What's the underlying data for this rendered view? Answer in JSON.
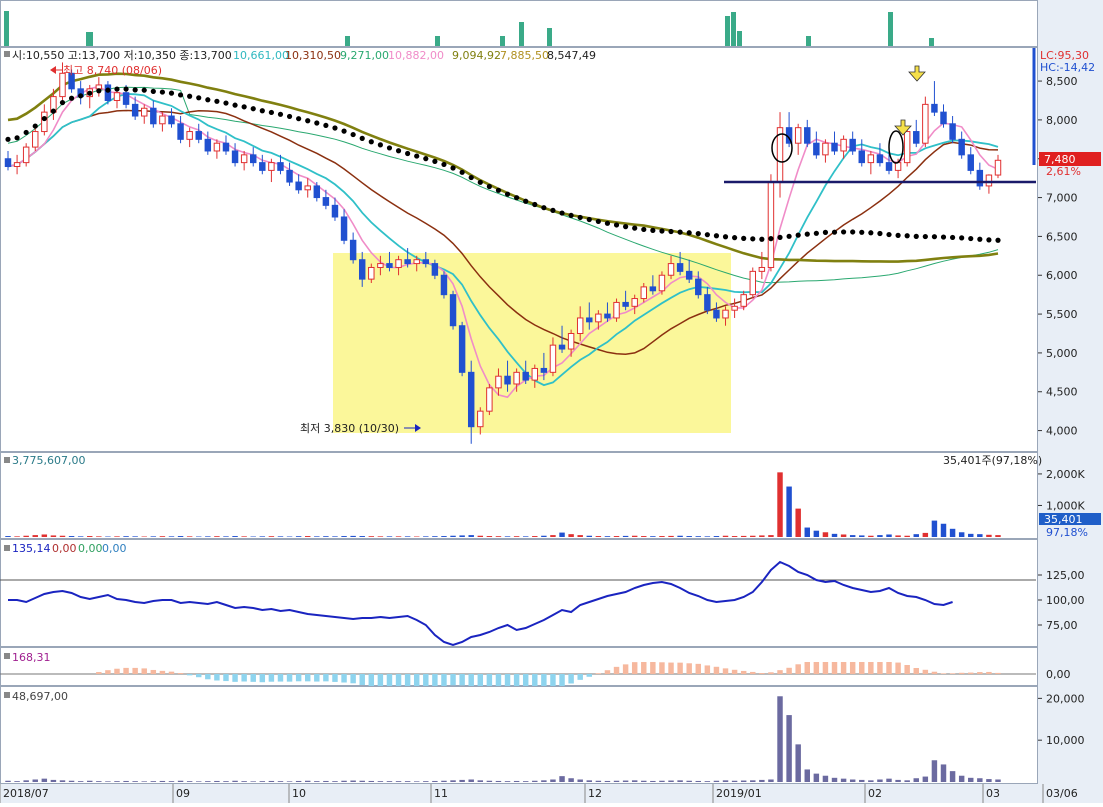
{
  "legend": {
    "ohlc": "시:10,550 고:13,700 저:10,350 종:13,700",
    "ma1": "10,661,00",
    "ma2": "10,310,50",
    "ma3": "9,271,00",
    "ma4": "10,882,00",
    "ma5": "9,094,92",
    "ma6": "7,885,50",
    "ma7": "8,547,49"
  },
  "colors": {
    "up": "#e03030",
    "down": "#2050d0",
    "ma5": "#f08cc8",
    "ma10": "#30c0c8",
    "ma20": "#8b3010",
    "ma60": "#2aa870",
    "ma120": "#808010",
    "dots": "#000000",
    "zone": "#fbf79a",
    "cci": "#1a24c0",
    "volIndicator": "#6b6aa0",
    "topBars": "#3aaa88"
  },
  "annotations": {
    "high": "최고 8,740 (08/06)",
    "low": "최저 3,830 (10/30)",
    "lc": "LC:95,30",
    "hc": "HC:-14,42",
    "last_price": "7,480",
    "last_change": "2,61%"
  },
  "volume_panel": {
    "value": "3,775,607,00",
    "right_value": "35,401주(97,18%)",
    "badge": "35,401",
    "badge_pct": "97,18%"
  },
  "osc_panel": {
    "value": "135,14",
    "v2": "0,00",
    "v3": "0,00",
    "v4": "0,00"
  },
  "macd_panel": {
    "value": "168,31"
  },
  "bottom_panel": {
    "value": "48,697,00"
  },
  "x_labels": [
    "2018/07",
    "09",
    "10",
    "11",
    "12",
    "2019/01",
    "02",
    "03",
    "03/06"
  ],
  "chart_data": {
    "type": "candlestick",
    "price_axis": {
      "ticks": [
        "8,500",
        "8,000",
        "7,500",
        "7,000",
        "6,500",
        "6,000",
        "5,500",
        "5,000",
        "4,500",
        "4,000"
      ],
      "range": [
        3750,
        8900
      ]
    },
    "volume_axis": {
      "ticks": [
        "2,000K",
        "1,000K"
      ]
    },
    "osc_axis": {
      "ticks": [
        "125,00",
        "100,00",
        "75,00"
      ]
    },
    "macd_axis": {
      "ticks": [
        "0,00"
      ]
    },
    "bottom_axis": {
      "ticks": [
        "20,000",
        "10,000"
      ]
    },
    "candles": [
      [
        7500,
        7600,
        7350,
        7400
      ],
      [
        7400,
        7550,
        7300,
        7450
      ],
      [
        7450,
        7700,
        7400,
        7650
      ],
      [
        7650,
        7900,
        7600,
        7850
      ],
      [
        7850,
        8200,
        7800,
        8100
      ],
      [
        8100,
        8400,
        8000,
        8300
      ],
      [
        8300,
        8740,
        8200,
        8600
      ],
      [
        8600,
        8650,
        8350,
        8400
      ],
      [
        8400,
        8500,
        8200,
        8300
      ],
      [
        8300,
        8450,
        8150,
        8400
      ],
      [
        8400,
        8550,
        8300,
        8450
      ],
      [
        8450,
        8500,
        8200,
        8250
      ],
      [
        8250,
        8400,
        8150,
        8350
      ],
      [
        8350,
        8450,
        8150,
        8200
      ],
      [
        8200,
        8300,
        8000,
        8050
      ],
      [
        8050,
        8200,
        7950,
        8150
      ],
      [
        8150,
        8250,
        7900,
        7950
      ],
      [
        7950,
        8100,
        7850,
        8050
      ],
      [
        8050,
        8150,
        7900,
        7950
      ],
      [
        7950,
        8050,
        7700,
        7750
      ],
      [
        7750,
        7900,
        7650,
        7850
      ],
      [
        7850,
        7950,
        7700,
        7750
      ],
      [
        7750,
        7850,
        7550,
        7600
      ],
      [
        7600,
        7750,
        7500,
        7700
      ],
      [
        7700,
        7800,
        7550,
        7600
      ],
      [
        7600,
        7700,
        7400,
        7450
      ],
      [
        7450,
        7600,
        7350,
        7550
      ],
      [
        7550,
        7650,
        7400,
        7450
      ],
      [
        7450,
        7550,
        7300,
        7350
      ],
      [
        7350,
        7500,
        7200,
        7450
      ],
      [
        7450,
        7550,
        7300,
        7350
      ],
      [
        7350,
        7450,
        7150,
        7200
      ],
      [
        7200,
        7300,
        7050,
        7100
      ],
      [
        7100,
        7250,
        7000,
        7150
      ],
      [
        7150,
        7200,
        6950,
        7000
      ],
      [
        7000,
        7100,
        6850,
        6900
      ],
      [
        6900,
        7000,
        6700,
        6750
      ],
      [
        6750,
        6850,
        6400,
        6450
      ],
      [
        6450,
        6550,
        6150,
        6200
      ],
      [
        6200,
        6300,
        5850,
        5950
      ],
      [
        5950,
        6150,
        5900,
        6100
      ],
      [
        6100,
        6250,
        6000,
        6150
      ],
      [
        6150,
        6300,
        6050,
        6100
      ],
      [
        6100,
        6250,
        6000,
        6200
      ],
      [
        6200,
        6350,
        6100,
        6150
      ],
      [
        6150,
        6250,
        6050,
        6200
      ],
      [
        6200,
        6300,
        6100,
        6150
      ],
      [
        6150,
        6200,
        5950,
        6000
      ],
      [
        6000,
        6050,
        5700,
        5750
      ],
      [
        5750,
        5800,
        5300,
        5350
      ],
      [
        5350,
        5400,
        4700,
        4750
      ],
      [
        4750,
        4900,
        3830,
        4050
      ],
      [
        4050,
        4300,
        3950,
        4250
      ],
      [
        4250,
        4600,
        4200,
        4550
      ],
      [
        4550,
        4800,
        4450,
        4700
      ],
      [
        4700,
        4900,
        4500,
        4600
      ],
      [
        4600,
        4800,
        4500,
        4750
      ],
      [
        4750,
        4900,
        4600,
        4650
      ],
      [
        4650,
        4850,
        4550,
        4800
      ],
      [
        4800,
        5000,
        4650,
        4750
      ],
      [
        4750,
        5200,
        4700,
        5100
      ],
      [
        5100,
        5350,
        5000,
        5050
      ],
      [
        5050,
        5300,
        4950,
        5250
      ],
      [
        5250,
        5600,
        5150,
        5450
      ],
      [
        5450,
        5650,
        5300,
        5400
      ],
      [
        5400,
        5550,
        5300,
        5500
      ],
      [
        5500,
        5650,
        5400,
        5450
      ],
      [
        5450,
        5700,
        5400,
        5650
      ],
      [
        5650,
        5800,
        5550,
        5600
      ],
      [
        5600,
        5750,
        5500,
        5700
      ],
      [
        5700,
        5900,
        5650,
        5850
      ],
      [
        5850,
        6000,
        5750,
        5800
      ],
      [
        5800,
        6050,
        5750,
        6000
      ],
      [
        6000,
        6250,
        5950,
        6150
      ],
      [
        6150,
        6300,
        6000,
        6050
      ],
      [
        6050,
        6200,
        5900,
        5950
      ],
      [
        5950,
        6050,
        5700,
        5750
      ],
      [
        5750,
        5850,
        5500,
        5550
      ],
      [
        5550,
        5650,
        5400,
        5450
      ],
      [
        5450,
        5600,
        5350,
        5550
      ],
      [
        5550,
        5700,
        5450,
        5600
      ],
      [
        5600,
        5800,
        5550,
        5750
      ],
      [
        5750,
        6100,
        5700,
        6050
      ],
      [
        6050,
        6300,
        5950,
        6100
      ],
      [
        6100,
        7300,
        6050,
        7200
      ],
      [
        7200,
        8100,
        7000,
        7900
      ],
      [
        7900,
        8100,
        7650,
        7700
      ],
      [
        7700,
        7950,
        7550,
        7900
      ],
      [
        7900,
        8000,
        7650,
        7700
      ],
      [
        7700,
        7850,
        7500,
        7550
      ],
      [
        7550,
        7750,
        7450,
        7700
      ],
      [
        7700,
        7850,
        7550,
        7600
      ],
      [
        7600,
        7800,
        7500,
        7750
      ],
      [
        7750,
        7850,
        7550,
        7600
      ],
      [
        7600,
        7750,
        7400,
        7450
      ],
      [
        7450,
        7600,
        7300,
        7550
      ],
      [
        7550,
        7700,
        7400,
        7450
      ],
      [
        7450,
        7600,
        7300,
        7350
      ],
      [
        7350,
        7500,
        7250,
        7450
      ],
      [
        7450,
        7900,
        7400,
        7850
      ],
      [
        7850,
        8000,
        7650,
        7700
      ],
      [
        7700,
        8300,
        7650,
        8200
      ],
      [
        8200,
        8500,
        8050,
        8100
      ],
      [
        8100,
        8200,
        7900,
        7950
      ],
      [
        7950,
        8050,
        7700,
        7750
      ],
      [
        7750,
        7850,
        7500,
        7550
      ],
      [
        7550,
        7650,
        7300,
        7350
      ],
      [
        7350,
        7450,
        7100,
        7150
      ],
      [
        7150,
        7300,
        7050,
        7290
      ],
      [
        7290,
        7550,
        7250,
        7480
      ]
    ],
    "volume": [
      30,
      20,
      40,
      60,
      80,
      50,
      40,
      30,
      20,
      30,
      20,
      15,
      20,
      25,
      20,
      15,
      20,
      25,
      20,
      30,
      20,
      15,
      20,
      25,
      20,
      30,
      20,
      15,
      20,
      25,
      20,
      15,
      25,
      30,
      20,
      25,
      20,
      30,
      35,
      30,
      25,
      20,
      20,
      20,
      20,
      15,
      20,
      25,
      30,
      40,
      50,
      60,
      40,
      30,
      25,
      20,
      25,
      20,
      30,
      40,
      60,
      140,
      90,
      60,
      40,
      30,
      25,
      30,
      35,
      40,
      30,
      25,
      30,
      35,
      40,
      30,
      25,
      20,
      30,
      40,
      30,
      35,
      40,
      50,
      60,
      2050,
      1600,
      900,
      300,
      200,
      150,
      100,
      80,
      60,
      50,
      40,
      60,
      80,
      50,
      40,
      90,
      130,
      520,
      420,
      260,
      150,
      100,
      90,
      70,
      60
    ],
    "cci": [
      100,
      100,
      98,
      102,
      106,
      108,
      109,
      107,
      103,
      101,
      103,
      105,
      101,
      100,
      98,
      97,
      99,
      100,
      100,
      97,
      98,
      97,
      96,
      98,
      95,
      92,
      93,
      92,
      90,
      91,
      89,
      90,
      88,
      86,
      85,
      84,
      83,
      82,
      81,
      82,
      82,
      83,
      82,
      83,
      84,
      80,
      75,
      65,
      58,
      55,
      58,
      63,
      65,
      68,
      72,
      75,
      70,
      72,
      76,
      80,
      85,
      90,
      88,
      95,
      98,
      101,
      104,
      106,
      108,
      112,
      115,
      117,
      118,
      116,
      112,
      107,
      104,
      100,
      98,
      99,
      100,
      103,
      108,
      118,
      130,
      138,
      134,
      128,
      125,
      120,
      118,
      119,
      115,
      112,
      110,
      108,
      109,
      112,
      107,
      104,
      103,
      100,
      96,
      95,
      98
    ]
  }
}
